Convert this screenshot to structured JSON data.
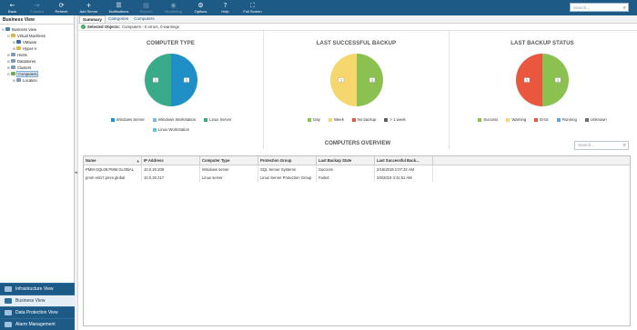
{
  "toolbar": {
    "buttons": [
      {
        "label": "Back",
        "icon": "←",
        "disabled": false
      },
      {
        "label": "Forward",
        "icon": "→",
        "disabled": true
      },
      {
        "label": "Refresh",
        "icon": "⟳",
        "disabled": false
      },
      {
        "label": "Add Server",
        "icon": "+",
        "disabled": false
      },
      {
        "label": "Notifications",
        "icon": "☰",
        "disabled": false
      },
      {
        "label": "Reports",
        "icon": "▤",
        "disabled": true
      },
      {
        "label": "Monitoring",
        "icon": "◉",
        "disabled": true
      },
      {
        "label": "Options",
        "icon": "⚙",
        "disabled": false
      },
      {
        "label": "Help",
        "icon": "?",
        "disabled": false
      },
      {
        "label": "Full Screen",
        "icon": "⛶",
        "disabled": false
      }
    ],
    "search_placeholder": "Search..."
  },
  "left": {
    "title": "Business View",
    "tree": [
      {
        "label": "Business View",
        "depth": 0,
        "toggle": "⊟",
        "color": "#4a7fb0"
      },
      {
        "label": "Virtual Machines",
        "depth": 1,
        "toggle": "⊟",
        "color": "#d9b84a"
      },
      {
        "label": "VMware",
        "depth": 2,
        "toggle": "⊞",
        "color": "#3b6ea5"
      },
      {
        "label": "Hyper-V",
        "depth": 2,
        "toggle": "⊞",
        "color": "#d9b84a"
      },
      {
        "label": "Hosts",
        "depth": 1,
        "toggle": "⊞",
        "color": "#7a9bb8"
      },
      {
        "label": "Datastores",
        "depth": 1,
        "toggle": "⊞",
        "color": "#7a9bb8"
      },
      {
        "label": "Clusters",
        "depth": 1,
        "toggle": "⊞",
        "color": "#7a9bb8"
      },
      {
        "label": "Computers",
        "depth": 1,
        "toggle": "⊟",
        "color": "#6fae4f",
        "selected": true
      },
      {
        "label": "Location",
        "depth": 2,
        "toggle": "⊞",
        "color": "#7a9bb8"
      }
    ],
    "nav": [
      {
        "label": "Infrastructure View",
        "active": false
      },
      {
        "label": "Business View",
        "active": true
      },
      {
        "label": "Data Protection View",
        "active": false
      },
      {
        "label": "Alarm Management",
        "active": false
      }
    ]
  },
  "main": {
    "tabs": [
      {
        "label": "Summary",
        "active": true
      },
      {
        "label": "Categories",
        "active": false
      },
      {
        "label": "Computers",
        "active": false
      }
    ],
    "selected_label": "Selected Objects:",
    "selected_text": "Computers - 0 errors, 0 warnings",
    "overview_title": "COMPUTERS OVERVIEW",
    "overview_search": "Search..."
  },
  "chart_data": [
    {
      "type": "pie",
      "title": "COMPUTER TYPE",
      "slices": [
        {
          "name": "Windows Server",
          "value": 1,
          "color": "#1f8fc6"
        },
        {
          "name": "Linux Server",
          "value": 1,
          "color": "#3aab8a"
        }
      ],
      "legend": [
        {
          "name": "Windows Server",
          "color": "#1f8fc6"
        },
        {
          "name": "Windows Workstation",
          "color": "#7fb7de"
        },
        {
          "name": "Linux Server",
          "color": "#3aab8a"
        },
        {
          "name": "Linux Workstation",
          "color": "#5fc5d5"
        }
      ]
    },
    {
      "type": "pie",
      "title": "LAST SUCCESSFUL BACKUP",
      "slices": [
        {
          "name": "Day",
          "value": 1,
          "color": "#8cc152"
        },
        {
          "name": "Week",
          "value": 1,
          "color": "#f5d76e"
        }
      ],
      "legend": [
        {
          "name": "Day",
          "color": "#8cc152"
        },
        {
          "name": "Week",
          "color": "#f5d76e"
        },
        {
          "name": "No backup",
          "color": "#e9573f"
        },
        {
          "name": "> 1 week",
          "color": "#5a5f66"
        }
      ]
    },
    {
      "type": "pie",
      "title": "LAST BACKUP STATUS",
      "slices": [
        {
          "name": "Success",
          "value": 1,
          "color": "#8cc152"
        },
        {
          "name": "Error",
          "value": 1,
          "color": "#e9573f"
        }
      ],
      "legend": [
        {
          "name": "Success",
          "color": "#8cc152"
        },
        {
          "name": "Warning",
          "color": "#f5d76e"
        },
        {
          "name": "Error",
          "color": "#e9573f"
        },
        {
          "name": "Running",
          "color": "#5da3e0"
        },
        {
          "name": "Unknown",
          "color": "#6d6d6d"
        }
      ]
    }
  ],
  "table": {
    "columns": [
      "Name",
      "IP Address",
      "Computer Type",
      "Protection Group",
      "Last Backup State",
      "Last Successful Back..."
    ],
    "rows": [
      [
        "PMM-SQL09.PMM.GLOBAL",
        "10.0.20.209",
        "Windows server",
        "SQL Server Systems",
        "Success",
        "2/15/2019 1:07:32 AM"
      ],
      [
        "pmm-vsl17.pmm.global",
        "10.0.20.217",
        "Linux server",
        "Linux Server Protection Group",
        "Failed",
        "2/8/2019 3:41:51 AM"
      ]
    ]
  }
}
